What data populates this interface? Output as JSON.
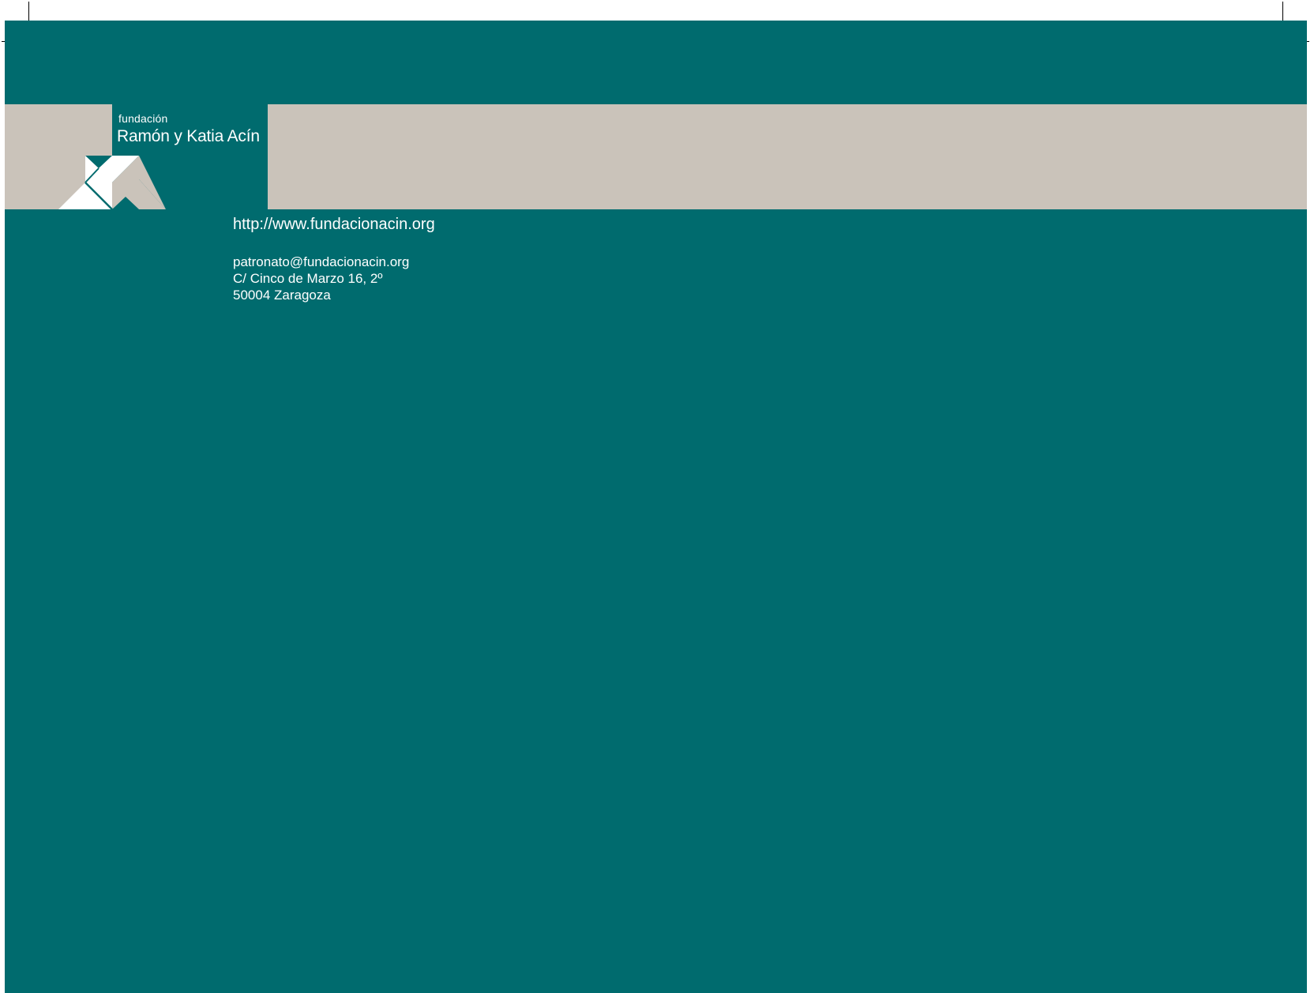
{
  "brand": {
    "small": "fundación",
    "name": "Ramón y Katia Acín"
  },
  "contact": {
    "website": "http://www.fundacionacin.org",
    "email": "patronato@fundacionacin.org",
    "street": "C/ Cinco de Marzo 16, 2º",
    "city": "50004 Zaragoza"
  },
  "colors": {
    "teal": "#006b6e",
    "stone": "#cac3ba",
    "white": "#ffffff"
  }
}
